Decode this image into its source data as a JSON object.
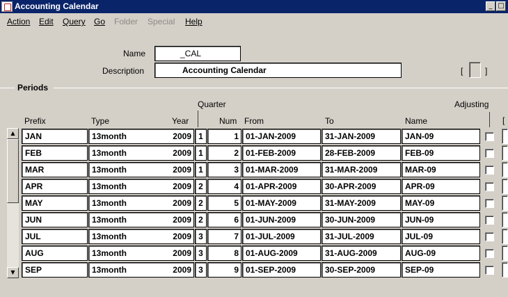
{
  "window": {
    "title": "Accounting Calendar"
  },
  "menu": [
    {
      "label": "Action",
      "enabled": true
    },
    {
      "label": "Edit",
      "enabled": true
    },
    {
      "label": "Query",
      "enabled": true
    },
    {
      "label": "Go",
      "enabled": true
    },
    {
      "label": "Folder",
      "enabled": false
    },
    {
      "label": "Special",
      "enabled": false
    },
    {
      "label": "Help",
      "enabled": true
    }
  ],
  "header": {
    "name_label": "Name",
    "name_value": "_CAL",
    "description_label": "Description",
    "description_value": "Accounting Calendar",
    "bracket_left": "[",
    "bracket_right": "]"
  },
  "periods": {
    "section_label": "Periods",
    "quarter_group_label": "Quarter",
    "adjusting_label": "Adjusting",
    "right_bracket": "[",
    "columns": {
      "prefix": "Prefix",
      "type": "Type",
      "year": "Year",
      "num": "Num",
      "from": "From",
      "to": "To",
      "name": "Name"
    },
    "rows": [
      {
        "prefix": "JAN",
        "type": "13month",
        "year": "2009",
        "quarter": "1",
        "num": "1",
        "from": "01-JAN-2009",
        "to": "31-JAN-2009",
        "name": "JAN-09",
        "adjusting": false
      },
      {
        "prefix": "FEB",
        "type": "13month",
        "year": "2009",
        "quarter": "1",
        "num": "2",
        "from": "01-FEB-2009",
        "to": "28-FEB-2009",
        "name": "FEB-09",
        "adjusting": false
      },
      {
        "prefix": "MAR",
        "type": "13month",
        "year": "2009",
        "quarter": "1",
        "num": "3",
        "from": "01-MAR-2009",
        "to": "31-MAR-2009",
        "name": "MAR-09",
        "adjusting": false
      },
      {
        "prefix": "APR",
        "type": "13month",
        "year": "2009",
        "quarter": "2",
        "num": "4",
        "from": "01-APR-2009",
        "to": "30-APR-2009",
        "name": "APR-09",
        "adjusting": false
      },
      {
        "prefix": "MAY",
        "type": "13month",
        "year": "2009",
        "quarter": "2",
        "num": "5",
        "from": "01-MAY-2009",
        "to": "31-MAY-2009",
        "name": "MAY-09",
        "adjusting": false
      },
      {
        "prefix": "JUN",
        "type": "13month",
        "year": "2009",
        "quarter": "2",
        "num": "6",
        "from": "01-JUN-2009",
        "to": "30-JUN-2009",
        "name": "JUN-09",
        "adjusting": false
      },
      {
        "prefix": "JUL",
        "type": "13month",
        "year": "2009",
        "quarter": "3",
        "num": "7",
        "from": "01-JUL-2009",
        "to": "31-JUL-2009",
        "name": "JUL-09",
        "adjusting": false
      },
      {
        "prefix": "AUG",
        "type": "13month",
        "year": "2009",
        "quarter": "3",
        "num": "8",
        "from": "01-AUG-2009",
        "to": "31-AUG-2009",
        "name": "AUG-09",
        "adjusting": false
      },
      {
        "prefix": "SEP",
        "type": "13month",
        "year": "2009",
        "quarter": "3",
        "num": "9",
        "from": "01-SEP-2009",
        "to": "30-SEP-2009",
        "name": "SEP-09",
        "adjusting": false
      }
    ]
  },
  "icons": {
    "app": "oracle-forms-icon",
    "minimize": "minimize-icon",
    "maximize": "maximize-icon",
    "scroll_up": "scroll-up-arrow-icon",
    "scroll_down": "scroll-down-arrow-icon"
  },
  "colors": {
    "titlebar": "#0a246a",
    "face": "#d4d0c8",
    "field": "#ffffff"
  }
}
